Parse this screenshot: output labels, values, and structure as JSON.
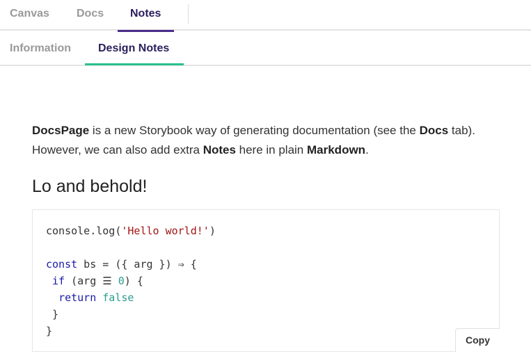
{
  "tabs": [
    {
      "label": "Canvas",
      "active": false
    },
    {
      "label": "Docs",
      "active": false
    },
    {
      "label": "Notes",
      "active": true
    }
  ],
  "subtabs": [
    {
      "label": "Information",
      "active": false
    },
    {
      "label": "Design Notes",
      "active": true
    }
  ],
  "notes": {
    "para_bold1": "DocsPage",
    "para_text1": " is a new Storybook way of generating documentation (see the ",
    "para_bold2": "Docs",
    "para_text2": " tab). However, we can also add extra ",
    "para_bold3": "Notes",
    "para_text3": " here in plain ",
    "para_bold4": "Markdown",
    "para_text4": ".",
    "heading": "Lo and behold!"
  },
  "code": {
    "line1_fn": "console.log(",
    "line1_str": "'Hello world!'",
    "line1_end": ")",
    "line3_kw": "const",
    "line3_rest": " bs = ({ arg }) ⇒ {",
    "line4_pre": " ",
    "line4_kw": "if",
    "line4_mid": " (arg ",
    "line4_op": "☰",
    "line4_sp": " ",
    "line4_num": "0",
    "line4_end": ") {",
    "line5_pre": "  ",
    "line5_kw": "return",
    "line5_sp": " ",
    "line5_bool": "false",
    "line6": " }",
    "line7": "}",
    "copy_label": "Copy"
  },
  "colors": {
    "active_tab": "#2b1f5c",
    "tab_underline": "#4a2d8a",
    "subtab_underline": "#2bbf8f",
    "keyword": "#1a1aa6",
    "string": "#a31515",
    "literal": "#2a9d8f"
  }
}
